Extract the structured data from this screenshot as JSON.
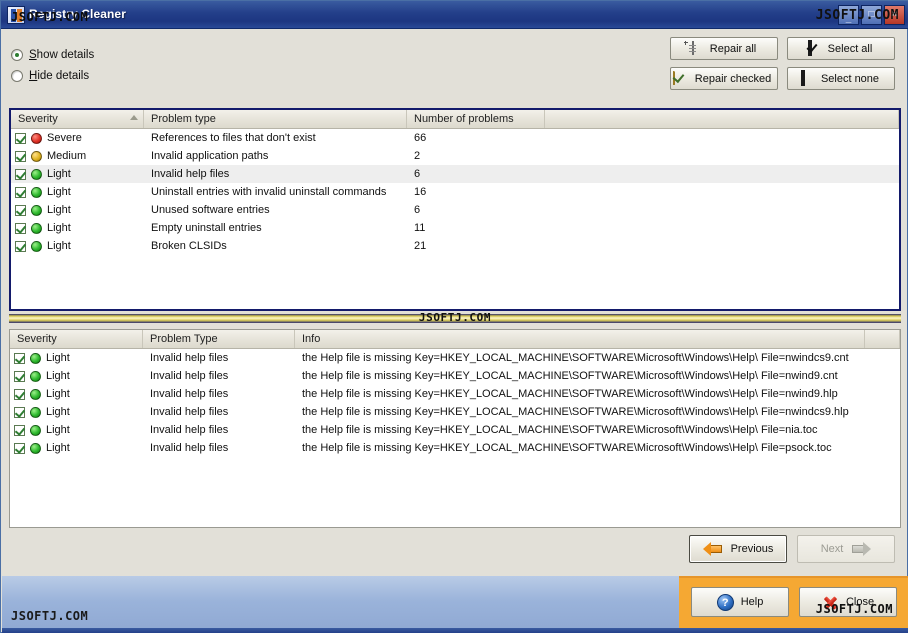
{
  "window": {
    "title": "Registry Cleaner",
    "icon": "app-icon",
    "controls": {
      "minimize": "_",
      "maximize": "□",
      "close": "✕"
    }
  },
  "watermarks": {
    "title": "JSOFTJ.COM",
    "top_right": "JSOFTJ.COM",
    "middle": "JSOFTJ.COM",
    "bottom_left": "JSOFTJ.COM",
    "bottom_right": "JSOFTJ.COM"
  },
  "options": {
    "show_details": {
      "label": "Show details",
      "accel": "S",
      "selected": true
    },
    "hide_details": {
      "label": "Hide details",
      "accel": "H",
      "selected": false
    }
  },
  "toolbar": {
    "repair_all": "Repair all",
    "repair_checked": "Repair checked",
    "select_all": "Select all",
    "select_none": "Select none"
  },
  "summary_grid": {
    "columns": [
      "Severity",
      "Problem type",
      "Number of problems"
    ],
    "sort_column": "Severity",
    "sort_direction": "ascending",
    "rows": [
      {
        "checked": true,
        "severity": "Severe",
        "level": "severe",
        "problem_type": "References to files that don't exist",
        "count": "66",
        "selected": false
      },
      {
        "checked": true,
        "severity": "Medium",
        "level": "medium",
        "problem_type": "Invalid application paths",
        "count": "2",
        "selected": false
      },
      {
        "checked": true,
        "severity": "Light",
        "level": "light",
        "problem_type": "Invalid help files",
        "count": "6",
        "selected": true
      },
      {
        "checked": true,
        "severity": "Light",
        "level": "light",
        "problem_type": "Uninstall entries with invalid uninstall commands",
        "count": "16",
        "selected": false
      },
      {
        "checked": true,
        "severity": "Light",
        "level": "light",
        "problem_type": "Unused software entries",
        "count": "6",
        "selected": false
      },
      {
        "checked": true,
        "severity": "Light",
        "level": "light",
        "problem_type": "Empty uninstall entries",
        "count": "11",
        "selected": false
      },
      {
        "checked": true,
        "severity": "Light",
        "level": "light",
        "problem_type": "Broken CLSIDs",
        "count": "21",
        "selected": false
      }
    ]
  },
  "detail_grid": {
    "columns": [
      "Severity",
      "Problem Type",
      "Info"
    ],
    "rows": [
      {
        "checked": true,
        "severity": "Light",
        "level": "light",
        "problem_type": "Invalid help files",
        "info": "the Help file is missing  Key=HKEY_LOCAL_MACHINE\\SOFTWARE\\Microsoft\\Windows\\Help\\  File=nwindcs9.cnt"
      },
      {
        "checked": true,
        "severity": "Light",
        "level": "light",
        "problem_type": "Invalid help files",
        "info": "the Help file is missing  Key=HKEY_LOCAL_MACHINE\\SOFTWARE\\Microsoft\\Windows\\Help\\  File=nwind9.cnt"
      },
      {
        "checked": true,
        "severity": "Light",
        "level": "light",
        "problem_type": "Invalid help files",
        "info": "the Help file is missing  Key=HKEY_LOCAL_MACHINE\\SOFTWARE\\Microsoft\\Windows\\Help\\  File=nwind9.hlp"
      },
      {
        "checked": true,
        "severity": "Light",
        "level": "light",
        "problem_type": "Invalid help files",
        "info": "the Help file is missing  Key=HKEY_LOCAL_MACHINE\\SOFTWARE\\Microsoft\\Windows\\Help\\  File=nwindcs9.hlp"
      },
      {
        "checked": true,
        "severity": "Light",
        "level": "light",
        "problem_type": "Invalid help files",
        "info": "the Help file is missing  Key=HKEY_LOCAL_MACHINE\\SOFTWARE\\Microsoft\\Windows\\Help\\  File=nia.toc"
      },
      {
        "checked": true,
        "severity": "Light",
        "level": "light",
        "problem_type": "Invalid help files",
        "info": "the Help file is missing  Key=HKEY_LOCAL_MACHINE\\SOFTWARE\\Microsoft\\Windows\\Help\\  File=psock.toc"
      }
    ]
  },
  "navigation": {
    "previous": {
      "label": "Previous",
      "enabled": true
    },
    "next": {
      "label": "Next",
      "enabled": false
    }
  },
  "footer": {
    "help": "Help",
    "close": "Close"
  },
  "colors": {
    "titlebar": "#24408a",
    "background": "#e2e0d8",
    "accent_orange": "#f5a833",
    "grid_focus_border": "#131a6b",
    "severity_severe": "#e03126",
    "severity_medium": "#e0b320",
    "severity_light": "#2db82d"
  }
}
